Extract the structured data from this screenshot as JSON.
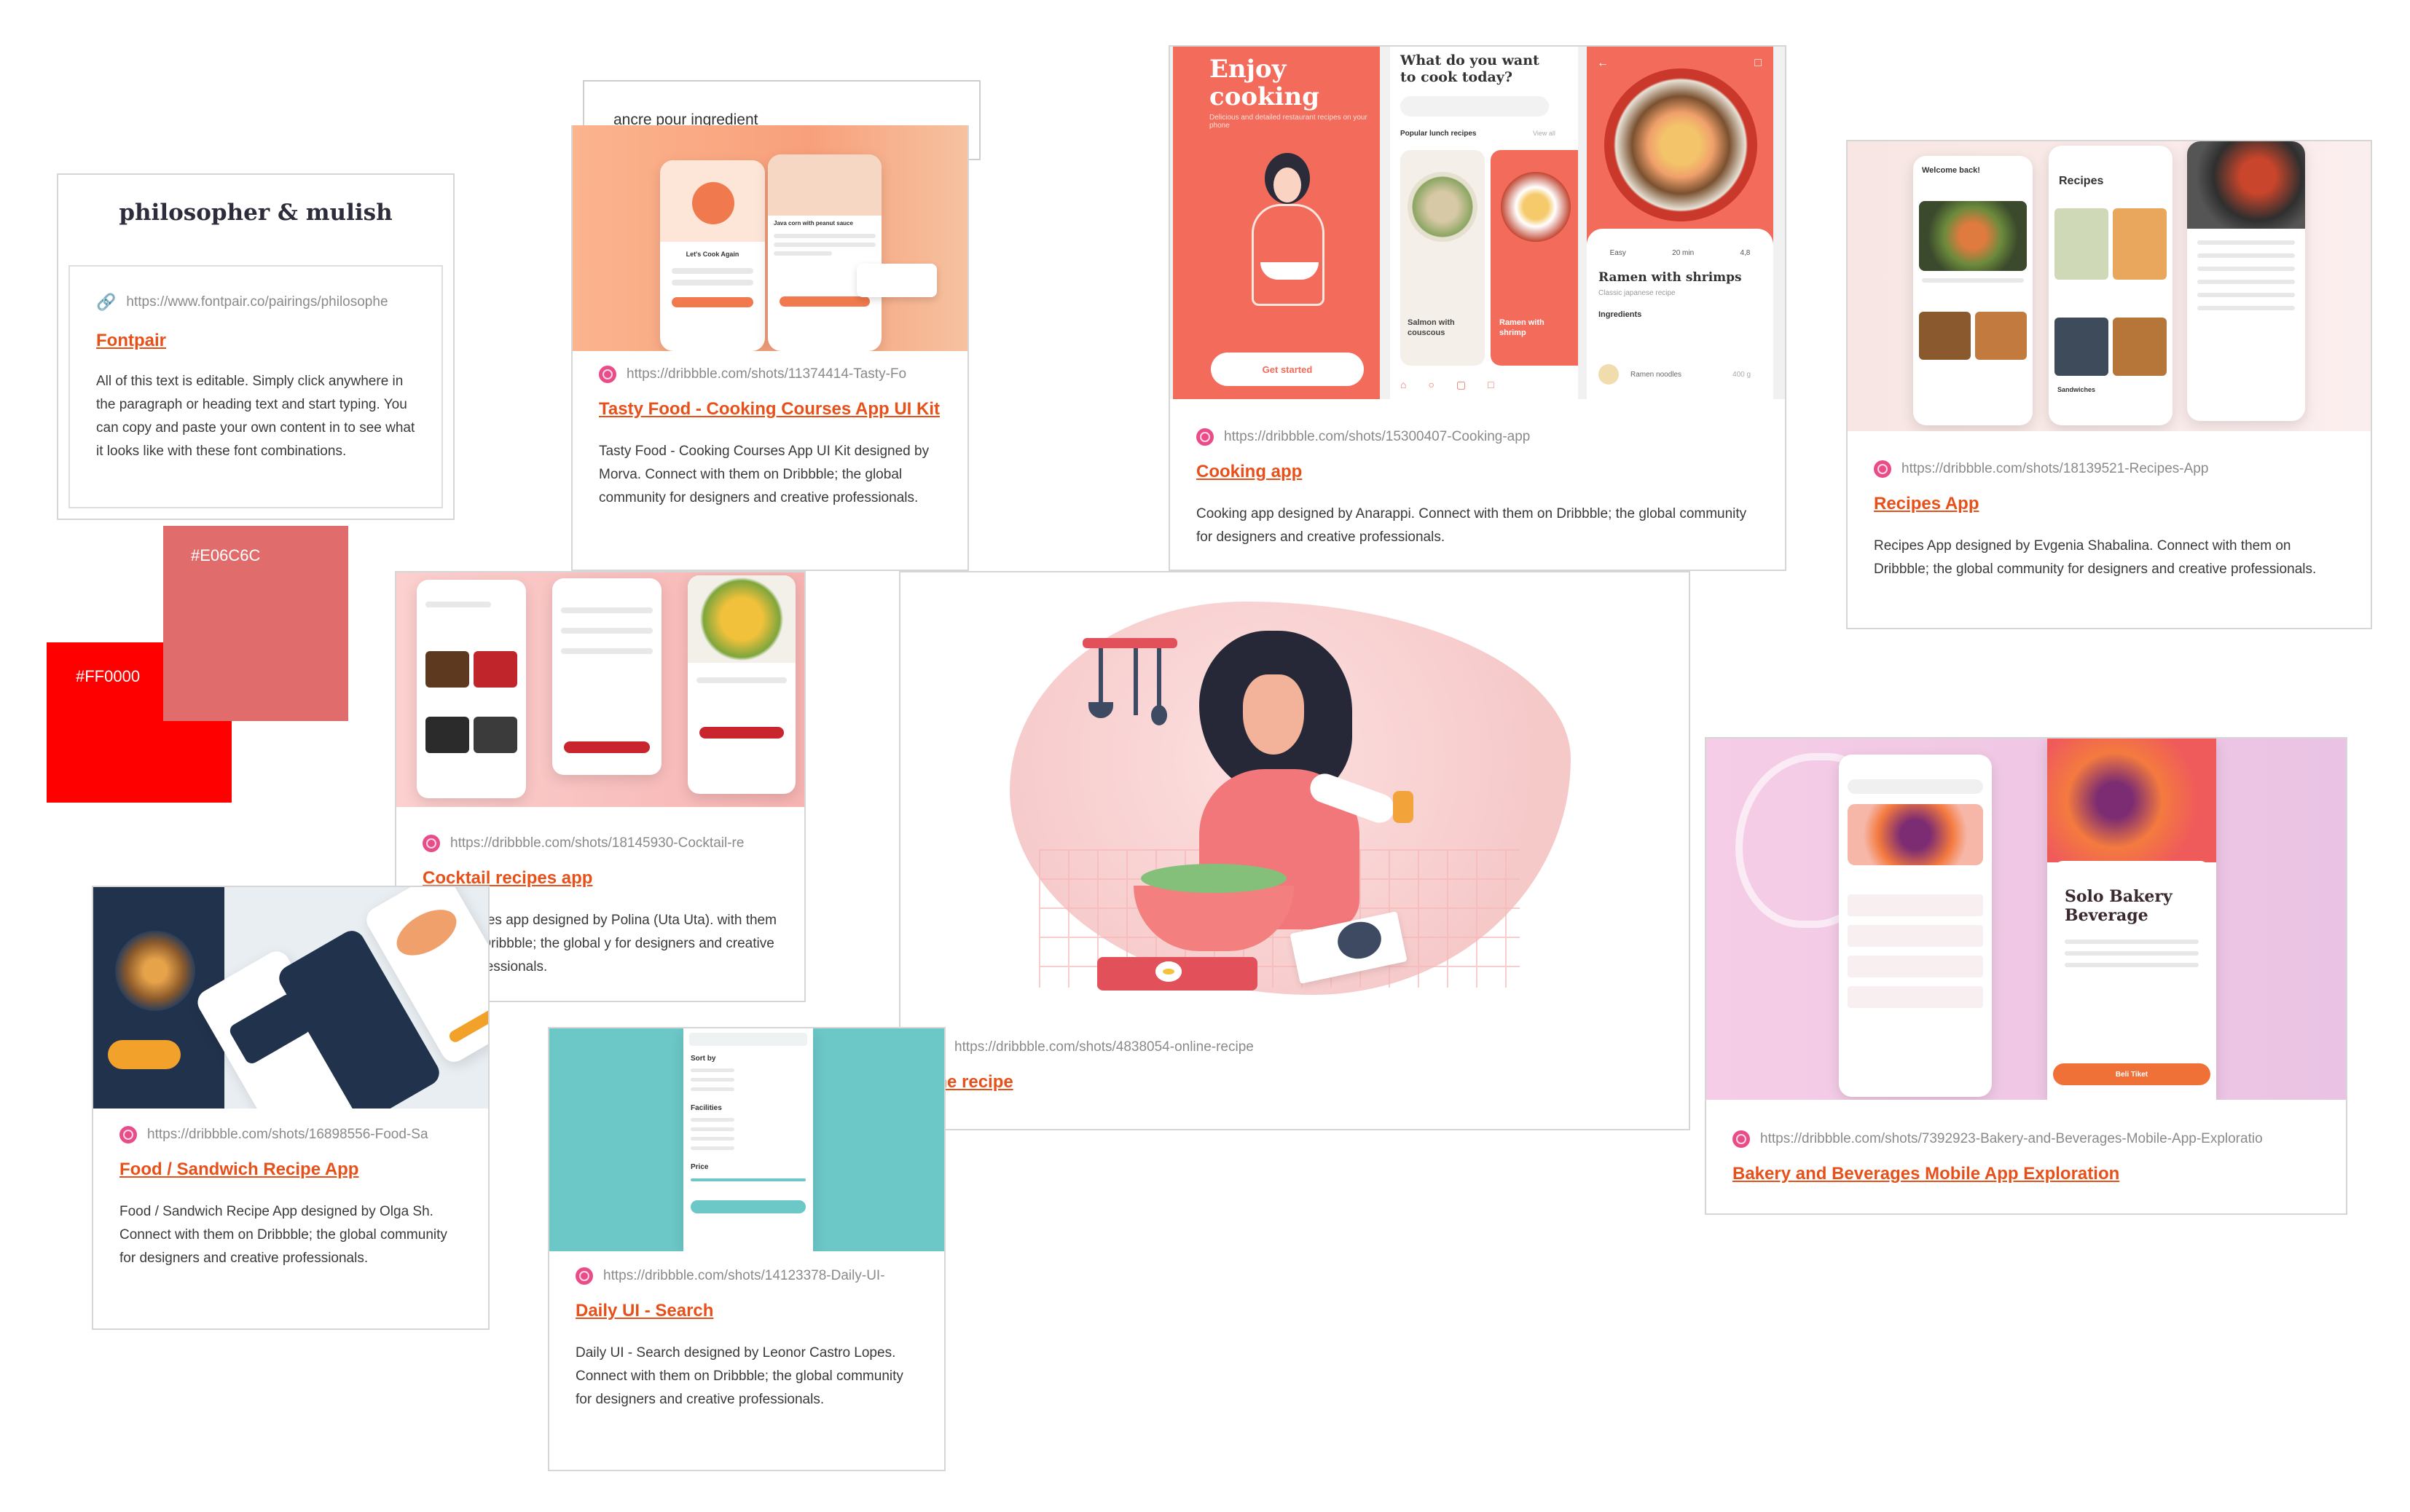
{
  "note_text": "ancre pour ingredient",
  "fontpair": {
    "heading": "philosopher & mulish",
    "url": "https://www.fontpair.co/pairings/philosophe",
    "title": "Fontpair",
    "desc": "All of this text is editable. Simply click anywhere in the paragraph or heading text and start typing. You can copy and paste your own content in to see what it looks like with these font combinations."
  },
  "swatches": [
    {
      "label": "#E06C6C",
      "color": "#E06C6C"
    },
    {
      "label": "#FF0000",
      "color": "#FF0000"
    }
  ],
  "cards": {
    "tasty": {
      "url": "https://dribbble.com/shots/11374414-Tasty-Fo",
      "title": "Tasty Food - Cooking Courses App UI Kit",
      "desc": "Tasty Food - Cooking Courses App UI Kit designed by Morva. Connect with them on Dribbble; the global community for designers and creative professionals.",
      "thumb_text": {
        "lets_cook": "Let's Cook Again",
        "recipe": "Java corn with peanut sauce"
      }
    },
    "cooking": {
      "url": "https://dribbble.com/shots/15300407-Cooking-app",
      "title": "Cooking app",
      "desc": "Cooking app designed by Anarappi. Connect with them on Dribbble; the global community for designers and creative professionals.",
      "thumb_text": {
        "enjoy": "Enjoy cooking",
        "enjoy_sub": "Delicious and detailed restaurant recipes on your phone",
        "get_started": "Get started",
        "question": "What do you want to cook today?",
        "popular": "Popular lunch recipes",
        "view_all": "View all",
        "salmon": "Salmon with couscous",
        "ramen_short": "Ramen with shrimp",
        "ramen_title": "Ramen with shrimps",
        "ramen_sub": "Classic japanese recipe",
        "easy": "Easy",
        "time": "20 min",
        "rating": "4,8",
        "ingredients": "Ingredients",
        "noodles": "Ramen noodles",
        "noodles_qty": "400 g"
      }
    },
    "recipes": {
      "url": "https://dribbble.com/shots/18139521-Recipes-App",
      "title": "Recipes App",
      "desc": "Recipes App designed by Evgenia Shabalina. Connect with them on Dribbble; the global community for designers and creative professionals.",
      "thumb_text": {
        "welcome": "Welcome back!",
        "recipes": "Recipes",
        "sandwiches": "Sandwiches"
      }
    },
    "cocktail": {
      "url": "https://dribbble.com/shots/18145930-Cocktail-re",
      "title": "Cocktail recipes app",
      "desc": "ecipes app designed by Polina (Uta Uta). with them on Dribbble; the global y for designers and creative professionals."
    },
    "online": {
      "url": "https://dribbble.com/shots/4838054-online-recipe",
      "title": "line recipe"
    },
    "bakery": {
      "url": "https://dribbble.com/shots/7392923-Bakery-and-Beverages-Mobile-App-Exploratio",
      "title": "Bakery and Beverages Mobile App Exploration",
      "thumb_text": {
        "solo": "Solo Bakery Beverage",
        "cta": "Beli Tiket"
      }
    },
    "food": {
      "url": "https://dribbble.com/shots/16898556-Food-Sa",
      "title": "Food / Sandwich Recipe App",
      "desc": "Food / Sandwich Recipe App designed by Olga Sh. Connect with them on Dribbble; the global community for designers and creative professionals."
    },
    "daily": {
      "url": "https://dribbble.com/shots/14123378-Daily-UI-",
      "title": "Daily UI - Search",
      "desc": "Daily UI - Search designed by Leonor Castro Lopes. Connect with them on Dribbble; the global community for designers and creative professionals.",
      "thumb_text": {
        "sort_by": "Sort by",
        "facilities": "Facilities",
        "price": "Price"
      }
    }
  },
  "colors": {
    "accent": "#e8501a",
    "dribbble": "#ea4c89",
    "coral": "#f26b5b",
    "teal": "#6cc7c7"
  }
}
